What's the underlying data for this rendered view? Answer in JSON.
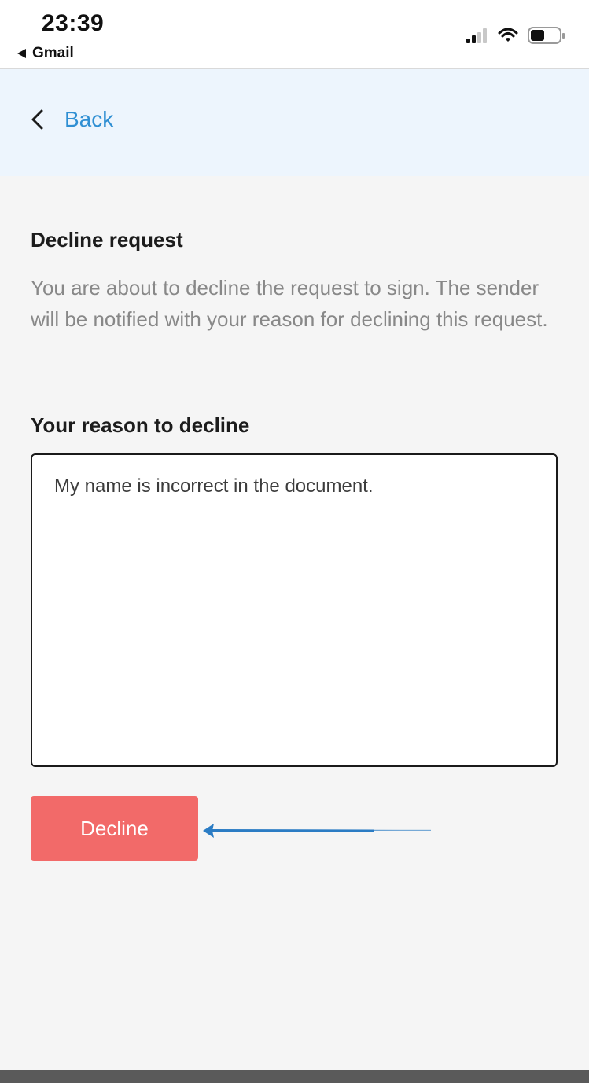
{
  "status_bar": {
    "time": "23:39",
    "back_app": "Gmail"
  },
  "nav": {
    "back_label": "Back"
  },
  "decline_section": {
    "title": "Decline request",
    "description": "You are about to decline the request to sign. The sender will be notified with your reason for declining this request.",
    "reason_label": "Your reason to decline",
    "reason_value": "My name is incorrect in the document.",
    "decline_button": "Decline"
  },
  "colors": {
    "accent_link": "#2f8fd3",
    "header_bg": "#edf5fd",
    "decline_button_bg": "#f26a69",
    "annotation_arrow": "#2b7cc4"
  }
}
